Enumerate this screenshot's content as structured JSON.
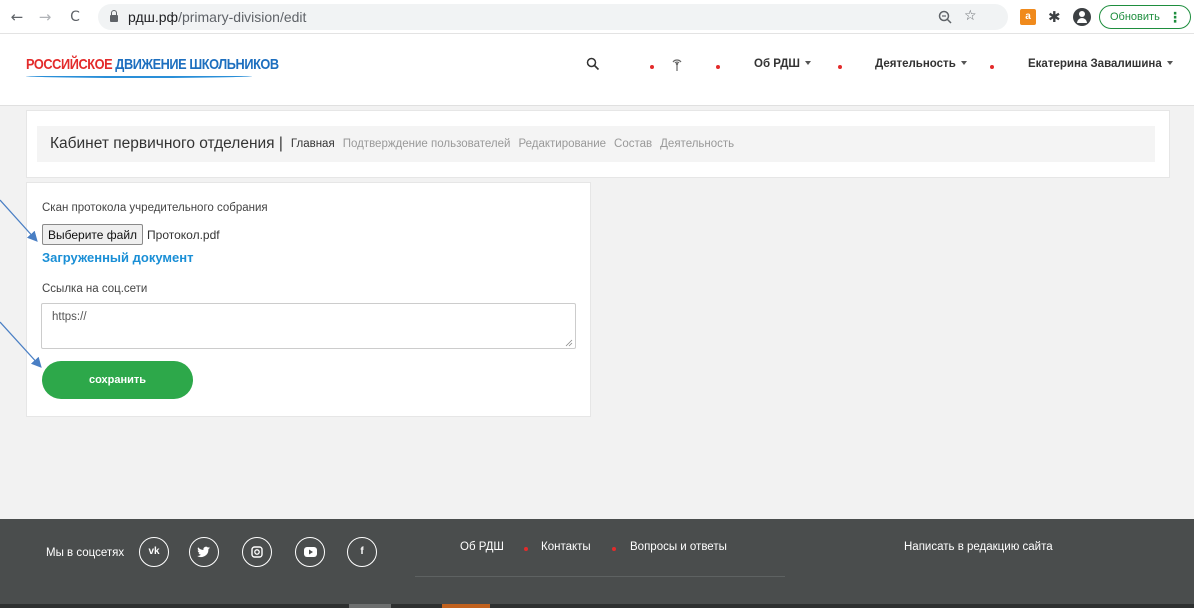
{
  "browser": {
    "url_host": "рдш.рф",
    "url_path": "/primary-division/edit",
    "update_label": "Обновить"
  },
  "header": {
    "logo_part1": "РОССИЙСКОЕ",
    "logo_part2": "ДВИЖЕНИЕ ШКОЛЬНИКОВ",
    "menu": {
      "about": "Об РДШ",
      "activity": "Деятельность",
      "user": "Екатерина Завалишина"
    }
  },
  "cabinet": {
    "title": "Кабинет первичного отделения |",
    "tabs": [
      "Главная",
      "Подтверждение пользователей",
      "Редактирование",
      "Состав",
      "Деятельность"
    ]
  },
  "form": {
    "scan_label": "Скан протокола учредительного собрания",
    "file_button": "Выберите файл",
    "file_name": "Протокол.pdf",
    "uploaded_link": "Загруженный документ",
    "social_label": "Ссылка на соц.сети",
    "social_value": "https://",
    "save_label": "сохранить"
  },
  "footer": {
    "social_title": "Мы в соцсетях",
    "social_icons": [
      "vk-icon",
      "twitter-icon",
      "instagram-icon",
      "youtube-icon",
      "facebook-icon"
    ],
    "links": [
      "Об РДШ",
      "Контакты",
      "Вопросы и ответы"
    ],
    "write_link": "Написать в редакцию сайта"
  },
  "colors": {
    "accent_red": "#e32b2b",
    "link_blue": "#1a8fd6",
    "save_green": "#2da84a",
    "footer_bg": "#4a4d4d"
  }
}
